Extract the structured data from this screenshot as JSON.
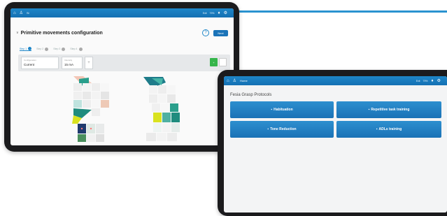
{
  "tablet1": {
    "topbar": {
      "home_icon": "home-icon",
      "user_icon": "user-icon",
      "user_text": "Si",
      "status_a": "Exit",
      "status_b": "79%",
      "settings_icon": "gear-icon"
    },
    "page_title": "Primitive movements configuration",
    "help_label": "?",
    "save_label": "Next",
    "steps": [
      {
        "label": "Step 1",
        "active": true
      },
      {
        "label": "Step 2",
        "active": false
      },
      {
        "label": "Step 3",
        "active": false
      },
      {
        "label": "Step 4",
        "active": false
      }
    ],
    "config": {
      "field1_label": "Configuration",
      "field1_value": "Current",
      "field2_label": "Intensity",
      "field2_value": "15 mA",
      "plus_label": "+",
      "go_label": "+"
    }
  },
  "tablet2": {
    "topbar": {
      "home_icon": "home-icon",
      "user_icon": "user-icon",
      "user_text": "Home",
      "status_a": "Exit",
      "status_b": "79%",
      "settings_icon": "gear-icon"
    },
    "title": "Fesia Grasp Protocols",
    "protocols": [
      {
        "label": "Habituation"
      },
      {
        "label": "Repetitive task training"
      },
      {
        "label": "Tone Reduction"
      },
      {
        "label": "ADLs training"
      }
    ]
  },
  "colors": {
    "accent": "#2a93d0",
    "topbar": "#1e86c8",
    "protocol_button": "#1f7dbf",
    "tablet_frame": "#1b1b1d",
    "go_button": "#35b54a"
  }
}
